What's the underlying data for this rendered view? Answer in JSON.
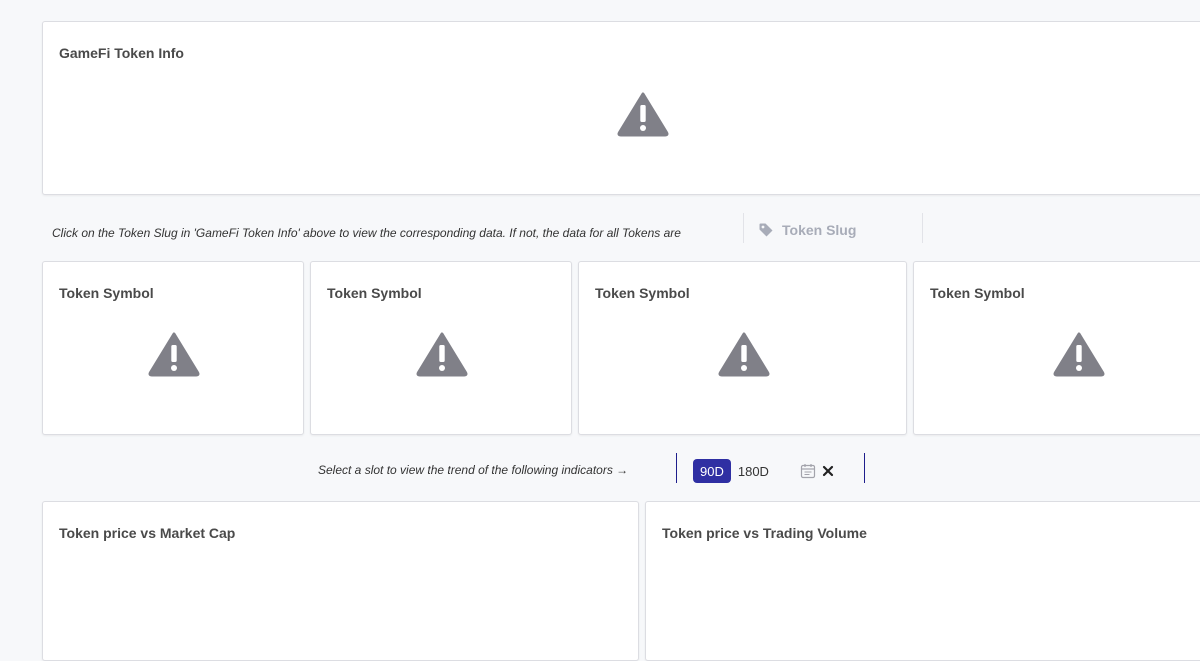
{
  "token_info": {
    "title": "GameFi Token Info",
    "status_icon": "warning-icon"
  },
  "slug_note": "Click on the Token Slug in 'GameFi Token Info' above to view the corresponding data. If not, the data for all Tokens are",
  "slug_filter": {
    "icon": "tag-icon",
    "placeholder": "Token Slug"
  },
  "symbol_cards": [
    {
      "title": "Token Symbol"
    },
    {
      "title": "Token Symbol"
    },
    {
      "title": "Token Symbol"
    },
    {
      "title": "Token Symbol"
    }
  ],
  "slot_note": "Select a slot to view the trend of the following indicators →",
  "time_range": {
    "options": [
      "90D",
      "180D"
    ],
    "selected": "90D",
    "calendar_icon": "calendar-icon",
    "clear_icon": "close-icon"
  },
  "charts": [
    {
      "title": "Token price vs Market Cap"
    },
    {
      "title": "Token price vs Trading Volume"
    }
  ],
  "colors": {
    "accent": "#2f2fa3",
    "warning_icon": "#808088",
    "background": "#f7f8fa",
    "card": "#ffffff",
    "divider": "#1e1e8c"
  }
}
